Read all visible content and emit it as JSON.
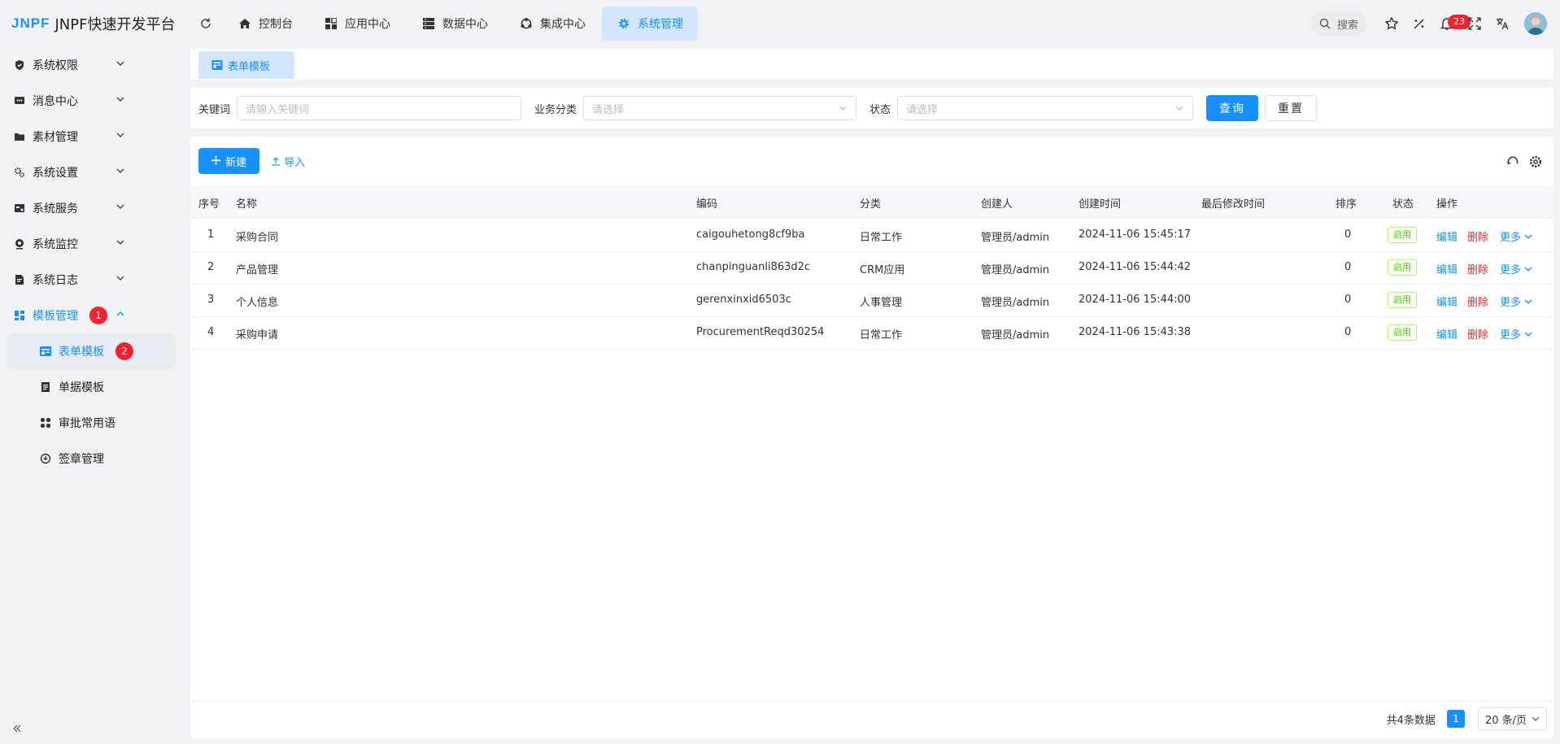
{
  "app": {
    "logo_mark": "JNPF",
    "title": "JNPF快速开发平台"
  },
  "topnav": [
    {
      "label": "控制台",
      "icon": "home-icon",
      "active": false
    },
    {
      "label": "应用中心",
      "icon": "grid-icon",
      "active": false
    },
    {
      "label": "数据中心",
      "icon": "database-icon",
      "active": false
    },
    {
      "label": "集成中心",
      "icon": "integration-icon",
      "active": false
    },
    {
      "label": "系统管理",
      "icon": "gear-icon",
      "active": true
    }
  ],
  "header": {
    "search_placeholder": "搜索",
    "notification_count": "23"
  },
  "sidebar": {
    "items": [
      {
        "label": "系统权限",
        "icon": "shield-icon"
      },
      {
        "label": "消息中心",
        "icon": "message-icon"
      },
      {
        "label": "素材管理",
        "icon": "folder-icon"
      },
      {
        "label": "系统设置",
        "icon": "settings-icon"
      },
      {
        "label": "系统服务",
        "icon": "service-icon"
      },
      {
        "label": "系统监控",
        "icon": "monitor-icon"
      },
      {
        "label": "系统日志",
        "icon": "log-icon"
      },
      {
        "label": "模板管理",
        "icon": "template-icon",
        "badge": "1",
        "open": true
      }
    ],
    "subitems": [
      {
        "label": "表单模板",
        "icon": "form-icon",
        "badge": "2",
        "active": true
      },
      {
        "label": "单据模板",
        "icon": "document-icon"
      },
      {
        "label": "审批常用语",
        "icon": "apps-icon"
      },
      {
        "label": "签章管理",
        "icon": "seal-icon"
      }
    ]
  },
  "tabs": [
    {
      "label": "表单模板"
    }
  ],
  "filters": {
    "keyword_label": "关键词",
    "keyword_placeholder": "请输入关键词",
    "category_label": "业务分类",
    "category_placeholder": "请选择",
    "status_label": "状态",
    "status_placeholder": "请选择",
    "query_button": "查询",
    "reset_button": "重置"
  },
  "toolbar": {
    "new_button": "新建",
    "import_button": "导入"
  },
  "table": {
    "columns": [
      "序号",
      "名称",
      "编码",
      "分类",
      "创建人",
      "创建时间",
      "最后修改时间",
      "排序",
      "状态",
      "操作"
    ],
    "rows": [
      {
        "index": "1",
        "name": "采购合同",
        "code": "caigouhetong8cf9ba",
        "category": "日常工作",
        "creator": "管理员/admin",
        "created": "2024-11-06 15:45:17",
        "modified": "",
        "sort": "0",
        "status": "启用"
      },
      {
        "index": "2",
        "name": "产品管理",
        "code": "chanpinguanli863d2c",
        "category": "CRM应用",
        "creator": "管理员/admin",
        "created": "2024-11-06 15:44:42",
        "modified": "",
        "sort": "0",
        "status": "启用"
      },
      {
        "index": "3",
        "name": "个人信息",
        "code": "gerenxinxid6503c",
        "category": "人事管理",
        "creator": "管理员/admin",
        "created": "2024-11-06 15:44:00",
        "modified": "",
        "sort": "0",
        "status": "启用"
      },
      {
        "index": "4",
        "name": "采购申请",
        "code": "ProcurementReqd30254",
        "category": "日常工作",
        "creator": "管理员/admin",
        "created": "2024-11-06 15:43:38",
        "modified": "",
        "sort": "0",
        "status": "启用"
      }
    ],
    "actions": {
      "edit": "编辑",
      "delete": "删除",
      "more": "更多"
    }
  },
  "pagination": {
    "total_text": "共4条数据",
    "current_page": "1",
    "page_size": "20 条/页"
  },
  "colors": {
    "primary": "#1890ff",
    "danger": "#f5222d",
    "success": "#52c41a"
  }
}
